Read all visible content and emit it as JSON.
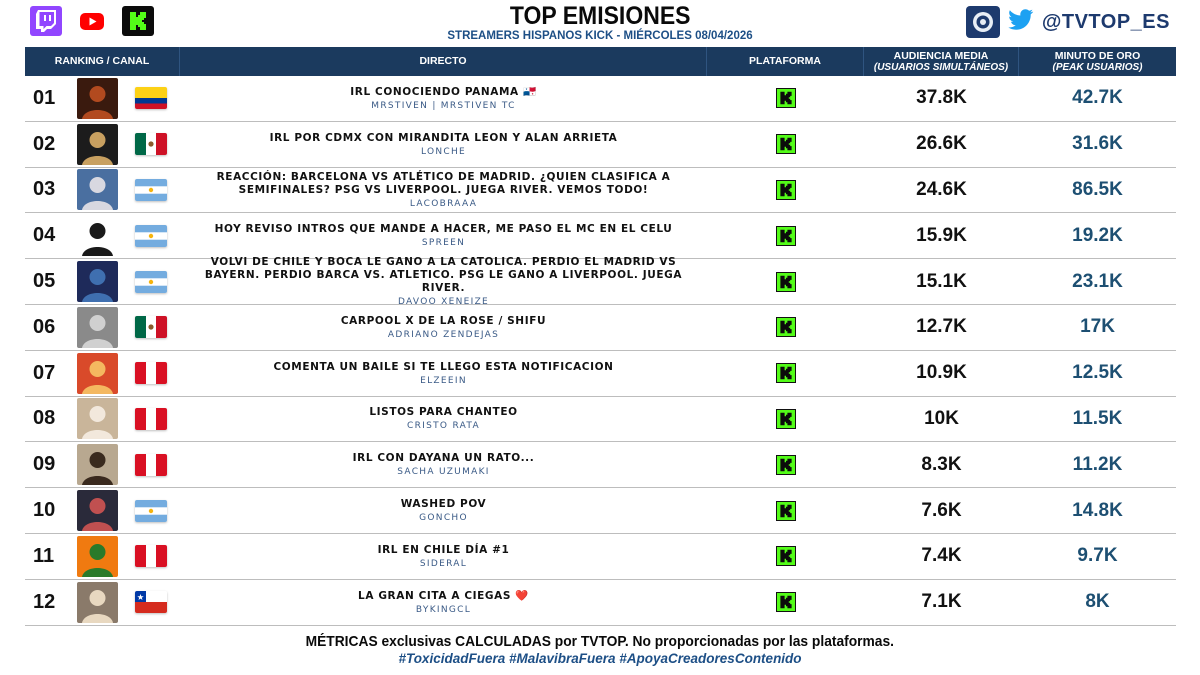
{
  "header": {
    "title": "TOP EMISIONES",
    "subtitle": "STREAMERS HISPANOS KICK - MIÉRCOLES 08/04/2026",
    "handle": "@TVTOP_ES",
    "left_logos": [
      "twitch-logo",
      "youtube-logo",
      "kick-logo"
    ],
    "right_logos": [
      "tvtop-logo",
      "twitter-bird-icon"
    ]
  },
  "columns": {
    "ranking": "RANKING / CANAL",
    "live": "DIRECTO",
    "platform": "PLATAFORMA",
    "avg": "AUDIENCIA MEDIA",
    "avg_sub": "(USUARIOS SIMULTÁNEOS)",
    "peak": "MINUTO DE ORO",
    "peak_sub": "(PEAK USUARIOS)"
  },
  "rows": [
    {
      "rank": "01",
      "title": "IRL CONOCIENDO PANAMA 🇵🇦",
      "channel": "MRSTIVEN | MRSTIVEN TC",
      "country": "colombia",
      "platform": "kick",
      "avg": "37.8K",
      "peak": "42.7K"
    },
    {
      "rank": "02",
      "title": "IRL POR CDMX CON MIRANDITA LEON Y ALAN ARRIETA",
      "channel": "LONCHE",
      "country": "mexico",
      "platform": "kick",
      "avg": "26.6K",
      "peak": "31.6K"
    },
    {
      "rank": "03",
      "title": "REACCIÓN: BARCELONA VS ATLÉTICO DE MADRID. ¿QUIEN CLASIFICA A SEMIFINALES? PSG VS LIVERPOOL. JUEGA RIVER. VEMOS TODO!",
      "channel": "LACOBRAAA",
      "country": "argentina",
      "platform": "kick",
      "avg": "24.6K",
      "peak": "86.5K"
    },
    {
      "rank": "04",
      "title": "HOY REVISO INTROS QUE MANDE A HACER, ME PASO EL MC EN EL CELU",
      "channel": "SPREEN",
      "country": "argentina",
      "platform": "kick",
      "avg": "15.9K",
      "peak": "19.2K"
    },
    {
      "rank": "05",
      "title": "VOLVI DE CHILE Y BOCA LE GANO A LA CATOLICA. PERDIO EL MADRID VS BAYERN. PERDIO BARCA VS. ATLETICO. PSG LE GANO A LIVERPOOL. JUEGA RIVER.",
      "channel": "DAVOO XENEIZE",
      "country": "argentina",
      "platform": "kick",
      "avg": "15.1K",
      "peak": "23.1K"
    },
    {
      "rank": "06",
      "title": "CARPOOL X DE LA ROSE / SHIFU",
      "channel": "ADRIANO ZENDEJAS",
      "country": "mexico",
      "platform": "kick",
      "avg": "12.7K",
      "peak": "17K"
    },
    {
      "rank": "07",
      "title": "COMENTA UN BAILE SI TE LLEGO ESTA NOTIFICACION",
      "channel": "ELZEEIN",
      "country": "peru",
      "platform": "kick",
      "avg": "10.9K",
      "peak": "12.5K"
    },
    {
      "rank": "08",
      "title": "LISTOS PARA CHANTEO",
      "channel": "CRISTO RATA",
      "country": "peru",
      "platform": "kick",
      "avg": "10K",
      "peak": "11.5K"
    },
    {
      "rank": "09",
      "title": "IRL CON DAYANA UN RATO...",
      "channel": "SACHA UZUMAKI",
      "country": "peru",
      "platform": "kick",
      "avg": "8.3K",
      "peak": "11.2K"
    },
    {
      "rank": "10",
      "title": "WASHED POV",
      "channel": "GONCHO",
      "country": "argentina",
      "platform": "kick",
      "avg": "7.6K",
      "peak": "14.8K"
    },
    {
      "rank": "11",
      "title": "IRL EN CHILE DÍA #1",
      "channel": "SIDERAL",
      "country": "peru",
      "platform": "kick",
      "avg": "7.4K",
      "peak": "9.7K"
    },
    {
      "rank": "12",
      "title": "LA GRAN CITA A CIEGAS ❤️",
      "channel": "BYKINGCL",
      "country": "chile",
      "platform": "kick",
      "avg": "7.1K",
      "peak": "8K"
    }
  ],
  "footer": {
    "note": "MÉTRICAS exclusivas CALCULADAS por TVTOP. No proporcionadas por las plataformas.",
    "tags": "#ToxicidadFuera #MalavibraFuera #ApoyaCreadoresContenido"
  },
  "colors": {
    "header_bg": "#1b3a5e",
    "accent_blue": "#1d4f86",
    "kick_green": "#53fc18",
    "twitch_purple": "#9146ff",
    "youtube_red": "#ff0000"
  }
}
